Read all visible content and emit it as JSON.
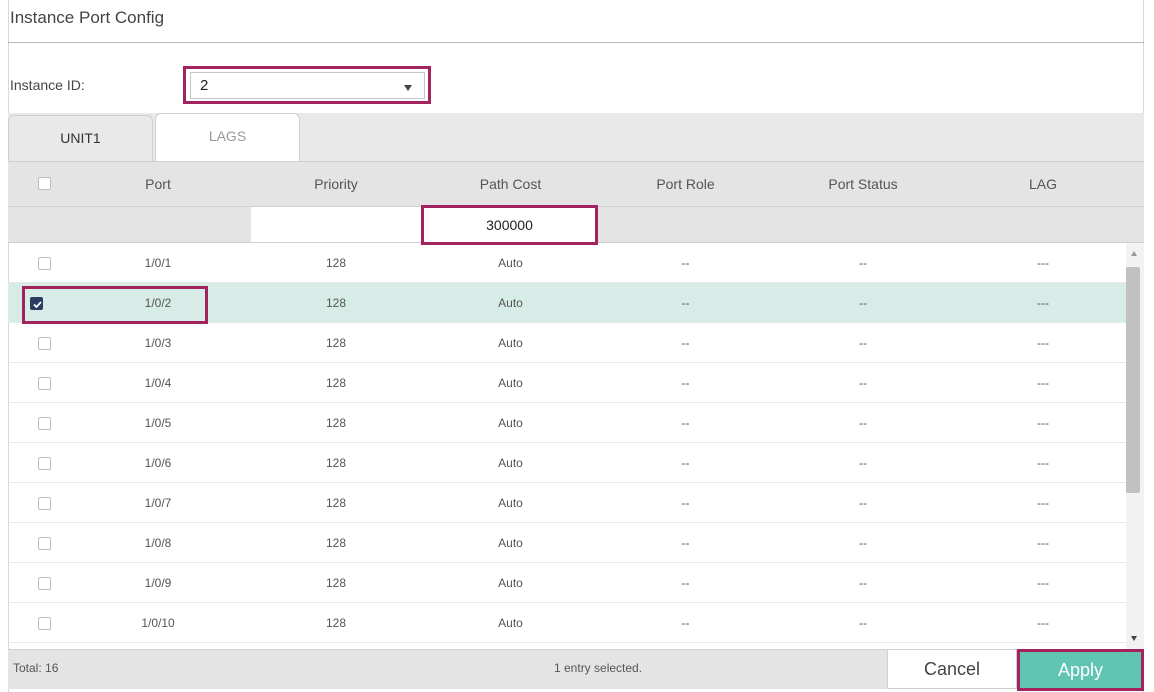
{
  "page": {
    "title": "Instance Port Config"
  },
  "instance": {
    "label": "Instance ID:",
    "value": "2"
  },
  "tabs": [
    {
      "label": "UNIT1",
      "active": true
    },
    {
      "label": "LAGS",
      "active": false
    }
  ],
  "table": {
    "columns": [
      "Port",
      "Priority",
      "Path Cost",
      "Port Role",
      "Port Status",
      "LAG"
    ],
    "filter": {
      "path_cost": "300000"
    },
    "rows": [
      {
        "port": "1/0/1",
        "priority": "128",
        "path_cost": "Auto",
        "role": "--",
        "status": "--",
        "lag": "---",
        "checked": false
      },
      {
        "port": "1/0/2",
        "priority": "128",
        "path_cost": "Auto",
        "role": "--",
        "status": "--",
        "lag": "---",
        "checked": true
      },
      {
        "port": "1/0/3",
        "priority": "128",
        "path_cost": "Auto",
        "role": "--",
        "status": "--",
        "lag": "---",
        "checked": false
      },
      {
        "port": "1/0/4",
        "priority": "128",
        "path_cost": "Auto",
        "role": "--",
        "status": "--",
        "lag": "---",
        "checked": false
      },
      {
        "port": "1/0/5",
        "priority": "128",
        "path_cost": "Auto",
        "role": "--",
        "status": "--",
        "lag": "---",
        "checked": false
      },
      {
        "port": "1/0/6",
        "priority": "128",
        "path_cost": "Auto",
        "role": "--",
        "status": "--",
        "lag": "---",
        "checked": false
      },
      {
        "port": "1/0/7",
        "priority": "128",
        "path_cost": "Auto",
        "role": "--",
        "status": "--",
        "lag": "---",
        "checked": false
      },
      {
        "port": "1/0/8",
        "priority": "128",
        "path_cost": "Auto",
        "role": "--",
        "status": "--",
        "lag": "---",
        "checked": false
      },
      {
        "port": "1/0/9",
        "priority": "128",
        "path_cost": "Auto",
        "role": "--",
        "status": "--",
        "lag": "---",
        "checked": false
      },
      {
        "port": "1/0/10",
        "priority": "128",
        "path_cost": "Auto",
        "role": "--",
        "status": "--",
        "lag": "---",
        "checked": false
      }
    ]
  },
  "footer": {
    "total": "Total: 16",
    "selected": "1 entry selected.",
    "cancel_label": "Cancel",
    "apply_label": "Apply"
  },
  "colors": {
    "highlight": "#a3235f",
    "apply": "#5fc4b0",
    "selected_row": "#d7ece7",
    "checkbox_checked": "#2c3d63"
  }
}
